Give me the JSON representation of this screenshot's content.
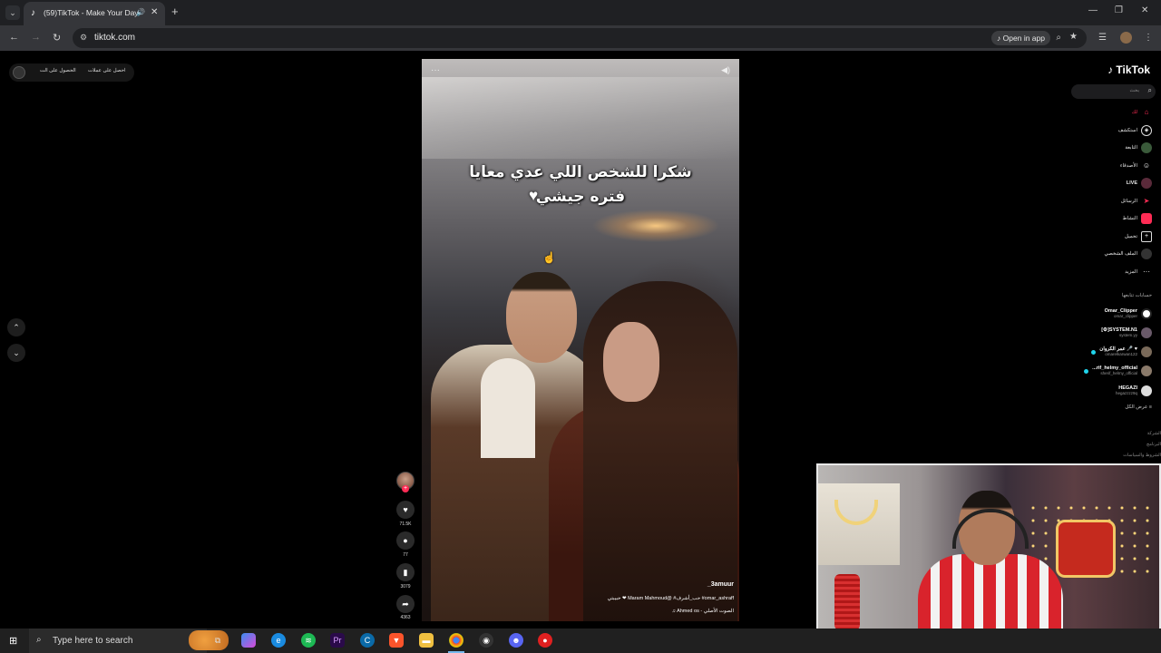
{
  "browser": {
    "tab": {
      "title": "(59)TikTok - Make Your Day",
      "favicon": "tiktok-icon"
    },
    "url": "tiktok.com",
    "open_in_app_label": "Open in app",
    "window_controls": [
      "—",
      "❐",
      "✕"
    ]
  },
  "page": {
    "top_left": {
      "item1": "احصل على عملات",
      "item2": "الحصول على الت"
    },
    "video": {
      "caption_line1": "شكرا للشخص اللي عدي معايا",
      "caption_line2": "فتره جيشي",
      "author": "_3amuur",
      "description": "حبيبتي ❤ Maram Mahmoud@ #حب_أشرف #omar_ashraff",
      "music": "♫ Ahmed os - الصوت الأصلي"
    },
    "actions": {
      "likes": "71.5K",
      "comments": "77",
      "saves": "3079",
      "shares": "4363"
    }
  },
  "sidebar": {
    "logo": "TikTok",
    "search_placeholder": "بحث",
    "nav": [
      {
        "label": "لك",
        "icon": "home-icon",
        "color": "#fe2c55"
      },
      {
        "label": "استكشف",
        "icon": "compass-icon",
        "color": "#222"
      },
      {
        "label": "التابعة",
        "icon": "following-icon",
        "color": "#3a5a3a"
      },
      {
        "label": "الأصدقاء",
        "icon": "friends-icon",
        "color": "#222"
      },
      {
        "label": "LIVE",
        "icon": "live-icon",
        "color": "#5a2a3a"
      },
      {
        "label": "الرسائل",
        "icon": "messages-icon",
        "color": "#fe2c55"
      },
      {
        "label": "النشاط",
        "icon": "activity-icon",
        "color": "#fe2c55"
      },
      {
        "label": "تحميل",
        "icon": "upload-icon",
        "color": "#222"
      },
      {
        "label": "الملف الشخصي",
        "icon": "profile-icon",
        "color": "#333"
      },
      {
        "label": "المزيد",
        "icon": "more-icon",
        "color": "#222"
      }
    ],
    "following_title": "حسابات تتابعها",
    "accounts": [
      {
        "name": "Omar_Clipper",
        "handle": "omar_clipper",
        "live": false
      },
      {
        "name": "[⚙]SYSTEM.N1",
        "handle": "system.yy",
        "live": false
      },
      {
        "name": "عمر الكروان 🎤 ♥",
        "handle": "omarelkarwan122",
        "live": true
      },
      {
        "name": "...rif_helmy_official",
        "handle": "sherif_helmy_official",
        "live": true
      },
      {
        "name": "HEGAZI",
        "handle": "hegazzzz9q",
        "live": false
      }
    ],
    "see_all": "عرض الكل",
    "footer": [
      "الشركة",
      "البرنامج",
      "الشروط والسياسات"
    ]
  },
  "taskbar": {
    "search_placeholder": "Type here to search"
  }
}
